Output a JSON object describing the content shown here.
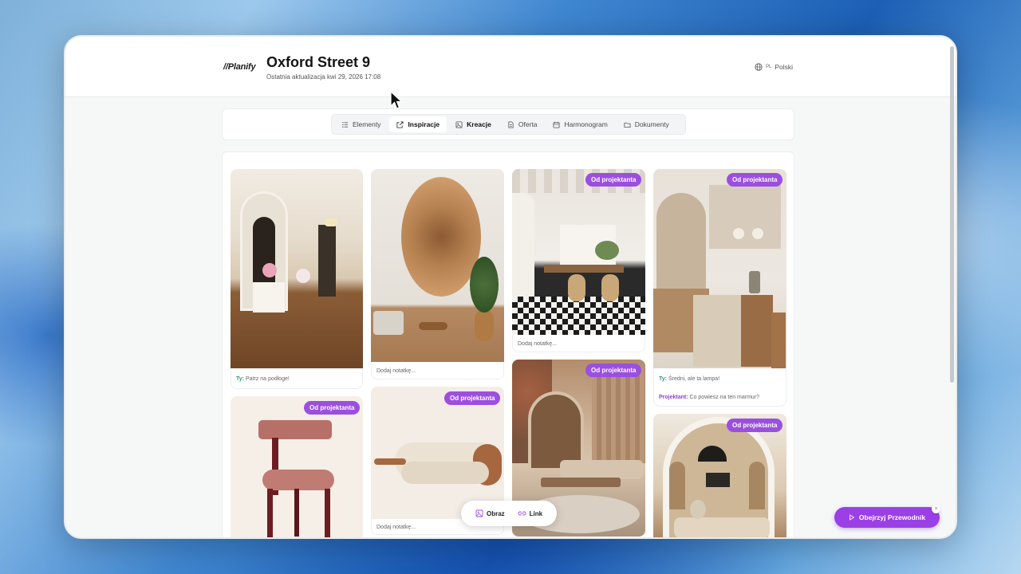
{
  "header": {
    "logo": "Planify",
    "title": "Oxford Street 9",
    "subtitle": "Ostatnia aktualizacja kwi 29, 2026 17:08",
    "lang_code": "PL",
    "lang_label": "Polski"
  },
  "tabs": [
    {
      "label": "Elementy",
      "icon": "list-icon"
    },
    {
      "label": "Inspiracje",
      "icon": "external-link-icon",
      "active": true
    },
    {
      "label": "Kreacje",
      "icon": "image-icon"
    },
    {
      "label": "Oferta",
      "icon": "document-icon"
    },
    {
      "label": "Harmonogram",
      "icon": "calendar-icon"
    },
    {
      "label": "Dokumenty",
      "icon": "folder-icon"
    }
  ],
  "badge_label": "Od projektanta",
  "notes": {
    "add_note": "Dodaj notatkę...",
    "you_prefix": "Ty:",
    "designer_prefix": "Projektant:",
    "hallway": "Patrz na podłoge!",
    "kitchen_you": "Średni, ale ta lampa!",
    "kitchen_designer": "Co powiesz na ten marmur?"
  },
  "float_bar": {
    "image_label": "Obraz",
    "link_label": "Link"
  },
  "guide_button": "Obejrzyj Przewodnik",
  "colors": {
    "accent": "#9b4fe0",
    "you_color": "#2e9c7a"
  }
}
